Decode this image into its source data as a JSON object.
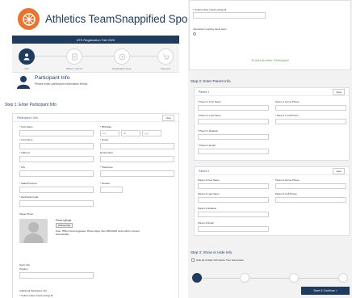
{
  "brand": {
    "title": "Athletics TeamSnappified Sports (ATS)",
    "logo_color": "#e87430"
  },
  "banner": {
    "text": "ATS Registration Fall 2020"
  },
  "stepper": {
    "steps": [
      {
        "label": "Info"
      },
      {
        "label": "Waiver / Forms"
      },
      {
        "label": "Registration Fees"
      },
      {
        "label": "Payment"
      }
    ]
  },
  "participant_info": {
    "title": "Participant Info",
    "subtitle": "Please enter participant information below."
  },
  "step1": {
    "title": "Step 1: Enter Participant Info"
  },
  "participant_card": {
    "title": "Participant 1 Info",
    "clear_label": "clear",
    "fields": {
      "first_name": "* First Name",
      "birthdate": "* Birthdate",
      "last_name": "* Last Name",
      "email": "* Email",
      "address": "* Address",
      "email_label": "Email Label",
      "city": "* City",
      "telephone": "* Telephone",
      "state": "* State/Province",
      "gender": "* Gender",
      "zip": "* Zip/Postal Code"
    },
    "dob_placeholders": [
      "mm",
      "dd",
      "yyyy"
    ],
    "photo": {
      "section_label": "Player Photo",
      "upload_title": "Photo Upload",
      "choose_file": "Choose File",
      "note": "Note: JPEG format suggested. Photos larger than 2000x2000 pixels will be cropped automatically."
    },
    "sport_info": {
      "label": "Sport Info",
      "position": "Position"
    },
    "additional": {
      "label": "Additional Participant Info",
      "uniform": "* Uniform Size (Youth sizing) ⊗"
    }
  },
  "right_top": {
    "uniform_label": "* Uniform Size (Youth sizing) ⊗",
    "travel_label": "Interested in joining travel team",
    "add_participant": "⊕ Add Another Participant"
  },
  "step2": {
    "title": "Step 2: Enter Parent Info"
  },
  "parent1": {
    "title": "Parent 1",
    "clear_label": "clear",
    "fields": {
      "first_name": "* Parent 1 First Name",
      "home_phone": "Parent 1 Home Phone",
      "last_name": "* Parent 1 Last Name",
      "cell_phone": "* Parent 1 Cell Phone",
      "relation": "* Parent 1 Relation",
      "email": "* Parent 1 Email"
    }
  },
  "parent2": {
    "title": "Parent 2",
    "clear_label": "clear",
    "fields": {
      "first_name": "Parent 2 First Name",
      "home_phone": "Parent 2 Home Phone",
      "last_name": "Parent 2 Last Name",
      "cell_phone": "Parent 2 Cell Phone",
      "relation": "Parent 2 Relation",
      "email": "Parent 2 Email"
    }
  },
  "step3": {
    "title": "Step 3: Show or Hide Info",
    "hide_label": "Hide all contact information from teammates"
  },
  "save_button": {
    "label": "Save & Continue >"
  }
}
